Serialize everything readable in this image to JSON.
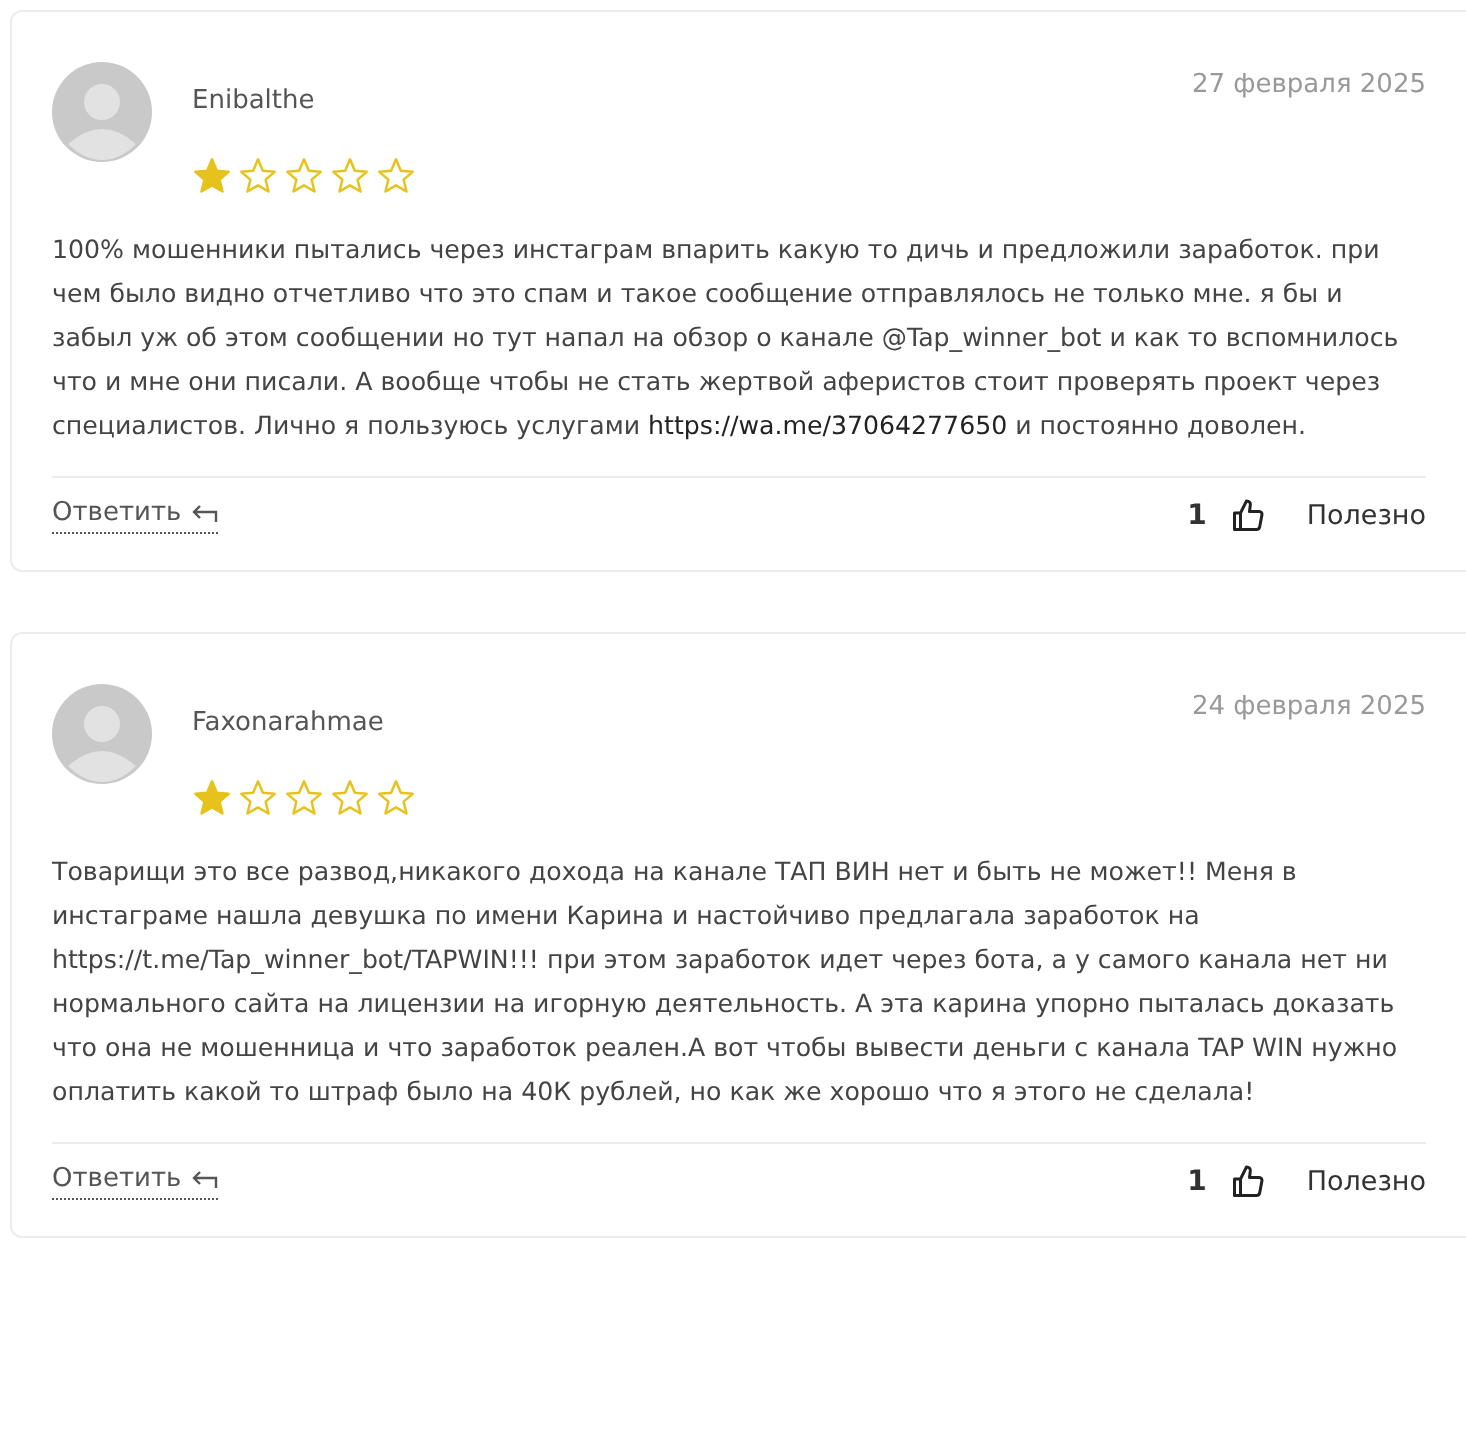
{
  "reviews": [
    {
      "author": "Enibalthe",
      "date": "27 февраля 2025",
      "stars": 1,
      "body": [
        {
          "kind": "text",
          "text": "100% мошенники пытались через инстаграм впарить какую то дичь и предложили заработок. при чем было видно отчетливо что это спам и такое сообщение отправлялось не только мне. я бы и забыл уж об этом сообщении но тут напал на обзор о канале @Tap_winner_bot и как то вспомнилось что и мне они писали. А вообще чтобы не стать жертвой аферистов стоит проверять проект через специалистов. Лично я пользуюсь услугами "
        },
        {
          "kind": "link",
          "text": "https://wa.me/37064277650"
        },
        {
          "kind": "text",
          "text": " и постоянно доволен."
        }
      ],
      "reply": "Ответить",
      "likes": "1",
      "useful": "Полезно"
    },
    {
      "author": "Faxonarahmae",
      "date": "24 февраля 2025",
      "stars": 1,
      "body": [
        {
          "kind": "text",
          "text": "Товарищи это все развод,никакого дохода на канале ТАП ВИН нет и быть не может!! Меня в инстаграме нашла девушка по имени Карина и настойчиво предлагала заработок на https://t.me/Tap_winner_bot/TAPWIN!!! при этом заработок идет через бота, а у самого канала нет ни нормального сайта на лицензии на игорную деятельность. А эта карина упорно пыталась доказать что она не мошенница и что заработок реален.А вот чтобы вывести деньги с канала TAP WIN нужно оплатить какой то штраф было на 40К рублей, но как же хорошо что я этого не сделала!"
        }
      ],
      "reply": "Ответить",
      "likes": "1",
      "useful": "Полезно"
    }
  ]
}
